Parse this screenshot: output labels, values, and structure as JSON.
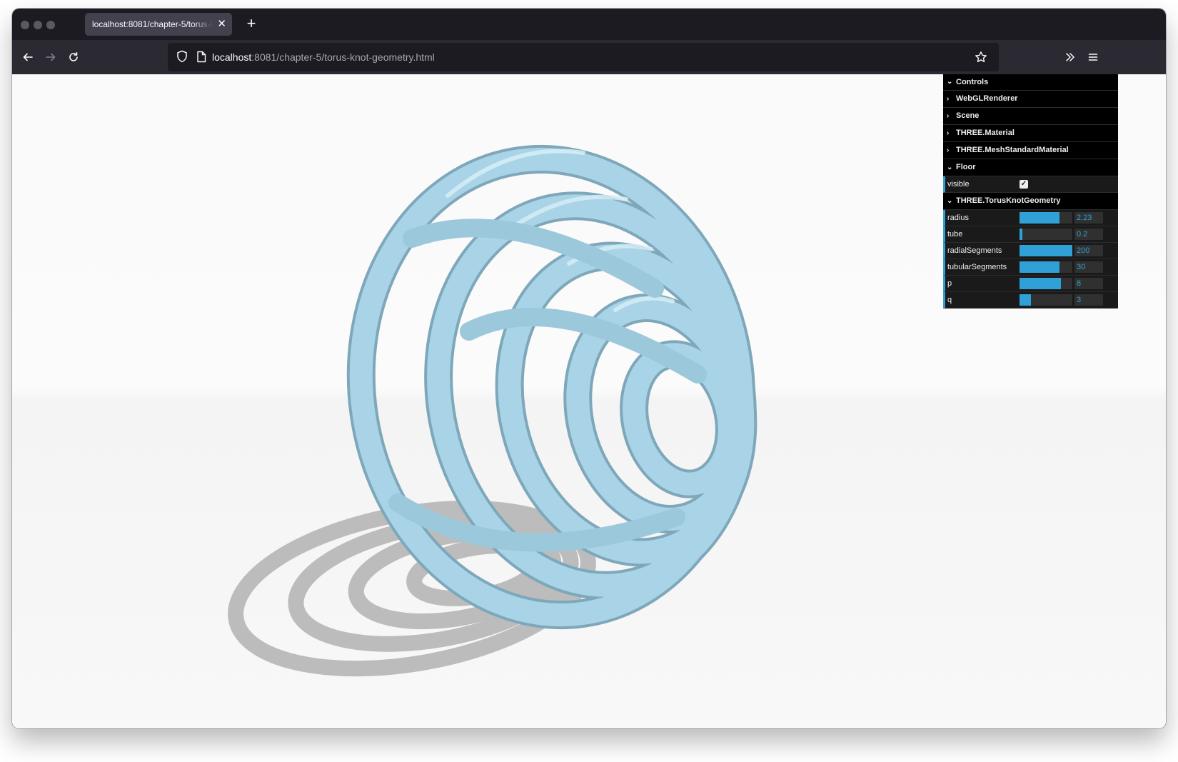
{
  "browser": {
    "tab_title": "localhost:8081/chapter-5/torus-knot-geometry.html",
    "tab_close_icon": "close-icon",
    "new_tab_label": "+",
    "url_host": "localhost",
    "url_rest": ":8081/chapter-5/torus-knot-geometry.html",
    "icons": [
      "back-arrow-icon",
      "forward-arrow-icon",
      "reload-icon",
      "shield-icon",
      "page-icon",
      "star-icon",
      "overflow-chevrons-icon",
      "menu-icon"
    ]
  },
  "gui": {
    "title": "Controls",
    "folders": {
      "webgl": "WebGLRenderer",
      "scene": "Scene",
      "material": "THREE.Material",
      "mesh_material": "THREE.MeshStandardMaterial",
      "floor": "Floor",
      "torus_knot": "THREE.TorusKnotGeometry"
    },
    "floor_visible": {
      "label": "visible",
      "checked": true
    },
    "params": [
      {
        "label": "radius",
        "value": "2.23",
        "fraction": 0.75
      },
      {
        "label": "tube",
        "value": "0.2",
        "fraction": 0.05
      },
      {
        "label": "radialSegments",
        "value": "200",
        "fraction": 1.0
      },
      {
        "label": "tubularSegments",
        "value": "30",
        "fraction": 0.75
      },
      {
        "label": "p",
        "value": "8",
        "fraction": 0.78
      },
      {
        "label": "q",
        "value": "3",
        "fraction": 0.22
      }
    ]
  },
  "scene": {
    "object": "torus-knot",
    "color": "#a9d3e6",
    "shadow_color": "#b7b7b7",
    "floor_color": "#f8f8f8",
    "accent": "#2fa1d6"
  }
}
